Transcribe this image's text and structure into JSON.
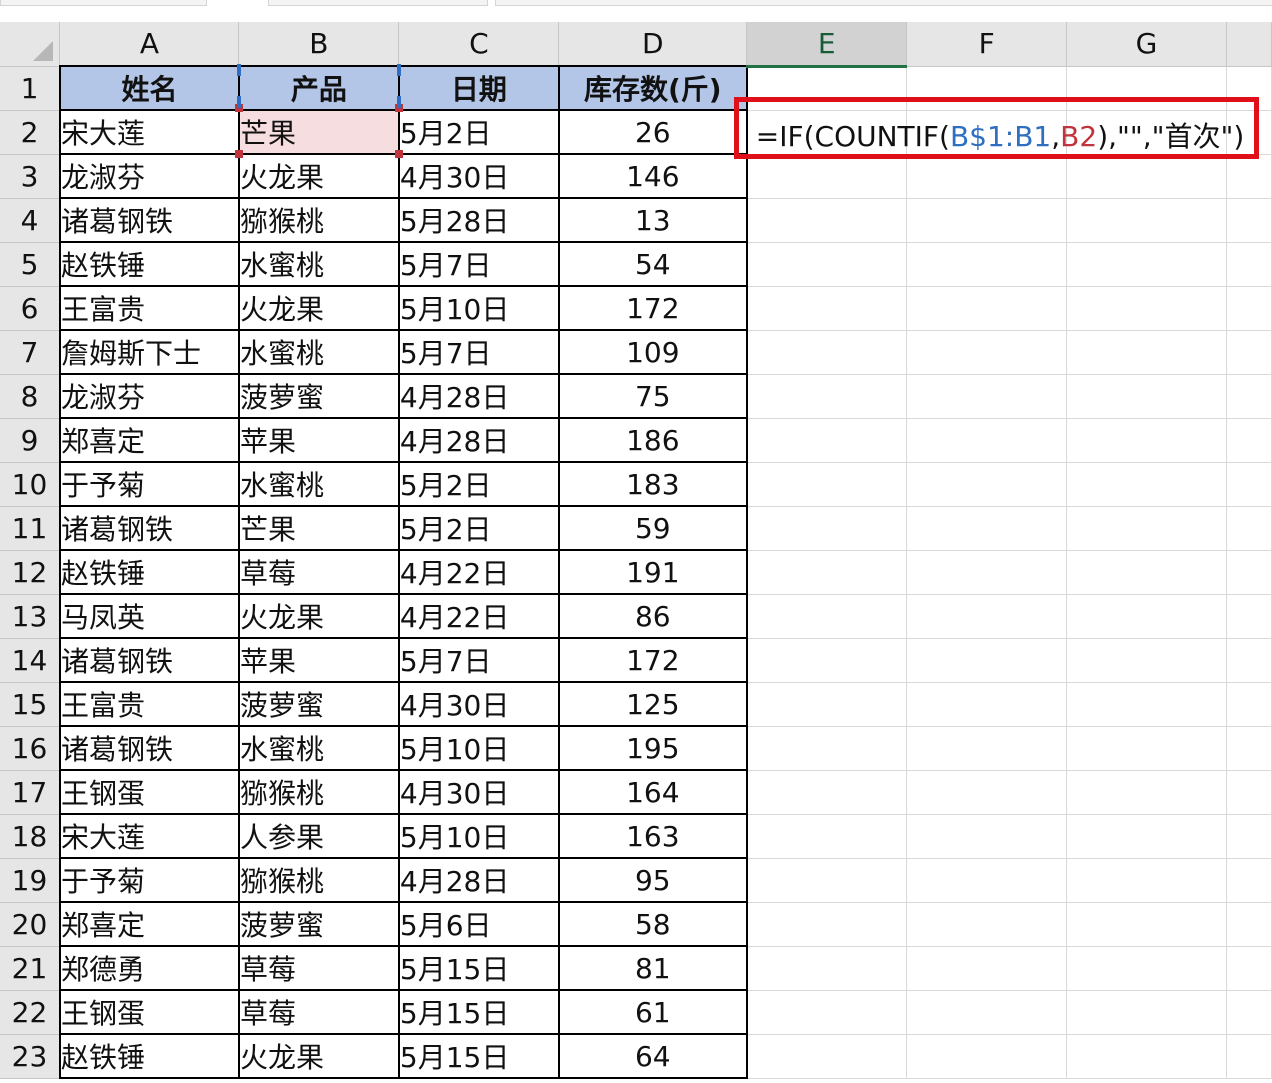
{
  "columns": [
    "A",
    "B",
    "C",
    "D",
    "E",
    "F",
    "G"
  ],
  "selected_column": "E",
  "header_row": {
    "row_number": "1",
    "cells": [
      "姓名",
      "产品",
      "日期",
      "库存数(斤)"
    ]
  },
  "rows": [
    {
      "n": "2",
      "name": "宋大莲",
      "product": "芒果",
      "date": "5月2日",
      "stock": "26"
    },
    {
      "n": "3",
      "name": "龙淑芬",
      "product": "火龙果",
      "date": "4月30日",
      "stock": "146"
    },
    {
      "n": "4",
      "name": "诸葛钢铁",
      "product": "猕猴桃",
      "date": "5月28日",
      "stock": "13"
    },
    {
      "n": "5",
      "name": "赵铁锤",
      "product": "水蜜桃",
      "date": "5月7日",
      "stock": "54"
    },
    {
      "n": "6",
      "name": "王富贵",
      "product": "火龙果",
      "date": "5月10日",
      "stock": "172"
    },
    {
      "n": "7",
      "name": "詹姆斯下士",
      "product": "水蜜桃",
      "date": "5月7日",
      "stock": "109"
    },
    {
      "n": "8",
      "name": "龙淑芬",
      "product": "菠萝蜜",
      "date": "4月28日",
      "stock": "75"
    },
    {
      "n": "9",
      "name": "郑喜定",
      "product": "苹果",
      "date": "4月28日",
      "stock": "186"
    },
    {
      "n": "10",
      "name": "于予菊",
      "product": "水蜜桃",
      "date": "5月2日",
      "stock": "183"
    },
    {
      "n": "11",
      "name": "诸葛钢铁",
      "product": "芒果",
      "date": "5月2日",
      "stock": "59"
    },
    {
      "n": "12",
      "name": "赵铁锤",
      "product": "草莓",
      "date": "4月22日",
      "stock": "191"
    },
    {
      "n": "13",
      "name": "马凤英",
      "product": "火龙果",
      "date": "4月22日",
      "stock": "86"
    },
    {
      "n": "14",
      "name": "诸葛钢铁",
      "product": "苹果",
      "date": "5月7日",
      "stock": "172"
    },
    {
      "n": "15",
      "name": "王富贵",
      "product": "菠萝蜜",
      "date": "4月30日",
      "stock": "125"
    },
    {
      "n": "16",
      "name": "诸葛钢铁",
      "product": "水蜜桃",
      "date": "5月10日",
      "stock": "195"
    },
    {
      "n": "17",
      "name": "王钢蛋",
      "product": "猕猴桃",
      "date": "4月30日",
      "stock": "164"
    },
    {
      "n": "18",
      "name": "宋大莲",
      "product": "人参果",
      "date": "5月10日",
      "stock": "163"
    },
    {
      "n": "19",
      "name": "于予菊",
      "product": "猕猴桃",
      "date": "4月28日",
      "stock": "95"
    },
    {
      "n": "20",
      "name": "郑喜定",
      "product": "菠萝蜜",
      "date": "5月6日",
      "stock": "58"
    },
    {
      "n": "21",
      "name": "郑德勇",
      "product": "草莓",
      "date": "5月15日",
      "stock": "81"
    },
    {
      "n": "22",
      "name": "王钢蛋",
      "product": "草莓",
      "date": "5月15日",
      "stock": "61"
    },
    {
      "n": "23",
      "name": "赵铁锤",
      "product": "火龙果",
      "date": "5月15日",
      "stock": "64"
    }
  ],
  "formula": {
    "cell": "E2",
    "prefix": "=IF(COUNTIF(",
    "ref1": "B$1:B1",
    "comma": ",",
    "ref2": "B2",
    "suffix": "),\"\",\"首次\")"
  },
  "colors": {
    "header_fill": "#b4c6e7",
    "highlight_box": "#e0101b",
    "ref1_color": "#2e6fc1",
    "ref2_color": "#c0343d",
    "ref2_fill": "#f6dde0"
  }
}
